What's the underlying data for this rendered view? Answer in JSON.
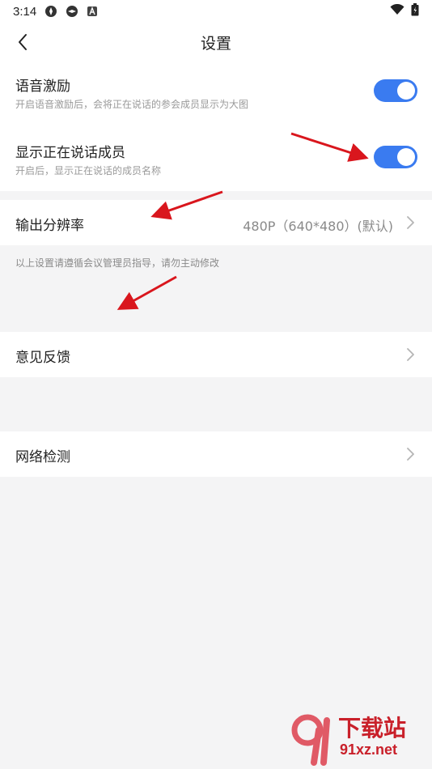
{
  "status_bar": {
    "time": "3:14"
  },
  "nav": {
    "title": "设置"
  },
  "settings": {
    "voice_excite": {
      "title": "语音激励",
      "desc": "开启语音激励后，会将正在说话的参会成员显示为大图",
      "enabled": true
    },
    "show_speaker": {
      "title": "显示正在说话成员",
      "desc": "开启后，显示正在说话的成员名称",
      "enabled": true
    },
    "resolution": {
      "label": "输出分辨率",
      "value": "480P（640*480）(默认)"
    },
    "hint": "以上设置请遵循会议管理员指导，请勿主动修改",
    "feedback": {
      "label": "意见反馈"
    },
    "network": {
      "label": "网络检测"
    }
  },
  "watermark": {
    "big": "下载站",
    "small": "91xz.net",
    "number": "91"
  },
  "colors": {
    "accent": "#3a7bf0",
    "arrow": "#d9161d",
    "watermark": "#c9202a"
  }
}
